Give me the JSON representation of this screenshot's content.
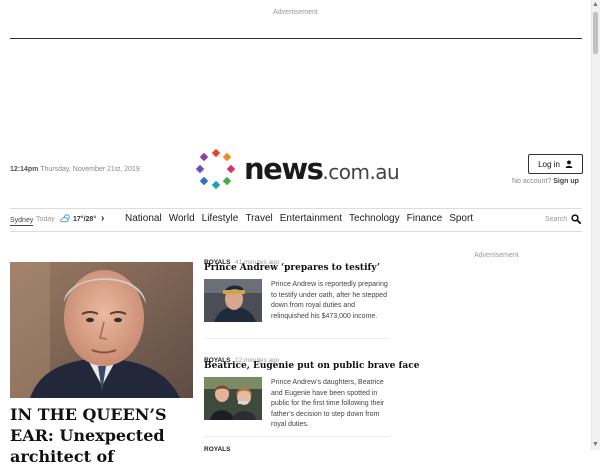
{
  "top_ad": {
    "label": "Advertisement"
  },
  "masthead": {
    "time": "12:14pm",
    "date": "Thursday, November 21st, 2019",
    "logo_main": "news",
    "logo_domain": ".com.au",
    "login_label": "Log in",
    "no_account": "No account?",
    "signup_label": "Sign up"
  },
  "nav": {
    "city": "Sydney",
    "today": "Today",
    "temps": "17°/28°",
    "items": [
      "National",
      "World",
      "Lifestyle",
      "Travel",
      "Entertainment",
      "Technology",
      "Finance",
      "Sport"
    ],
    "search_label": "Search"
  },
  "hero": {
    "title": "IN THE QUEEN’S EAR: Unexpected architect of"
  },
  "stories": [
    {
      "kicker": "ROYALS",
      "time": "41 minutes ago",
      "headline": "Prince Andrew ‘prepares to testify’",
      "body": "Prince Andrew is reportedly preparing to testify under oath, after he stepped down from royal duties and relinquished his $473,000 income."
    },
    {
      "kicker": "ROYALS",
      "time": "12 minutes ago",
      "headline": "Beatrice, Eugenie put on public brave face",
      "body": "Prince Andrew’s daughters, Beatrice and Eugenie have been spotted in public for the first time following their father’s decision to step down from royal duties."
    }
  ],
  "next_kicker": "ROYALS",
  "side_ad": {
    "label": "Advertisement"
  },
  "colors": {
    "dot_purple": "#8e3fa5",
    "dot_red": "#e8432e",
    "dot_orange": "#f08a24",
    "dot_green": "#49a942",
    "dot_teal": "#1ea1b5",
    "dot_blue": "#2c6fc9",
    "dot_magenta": "#d6336c",
    "dot_violet": "#6b4fbb"
  }
}
